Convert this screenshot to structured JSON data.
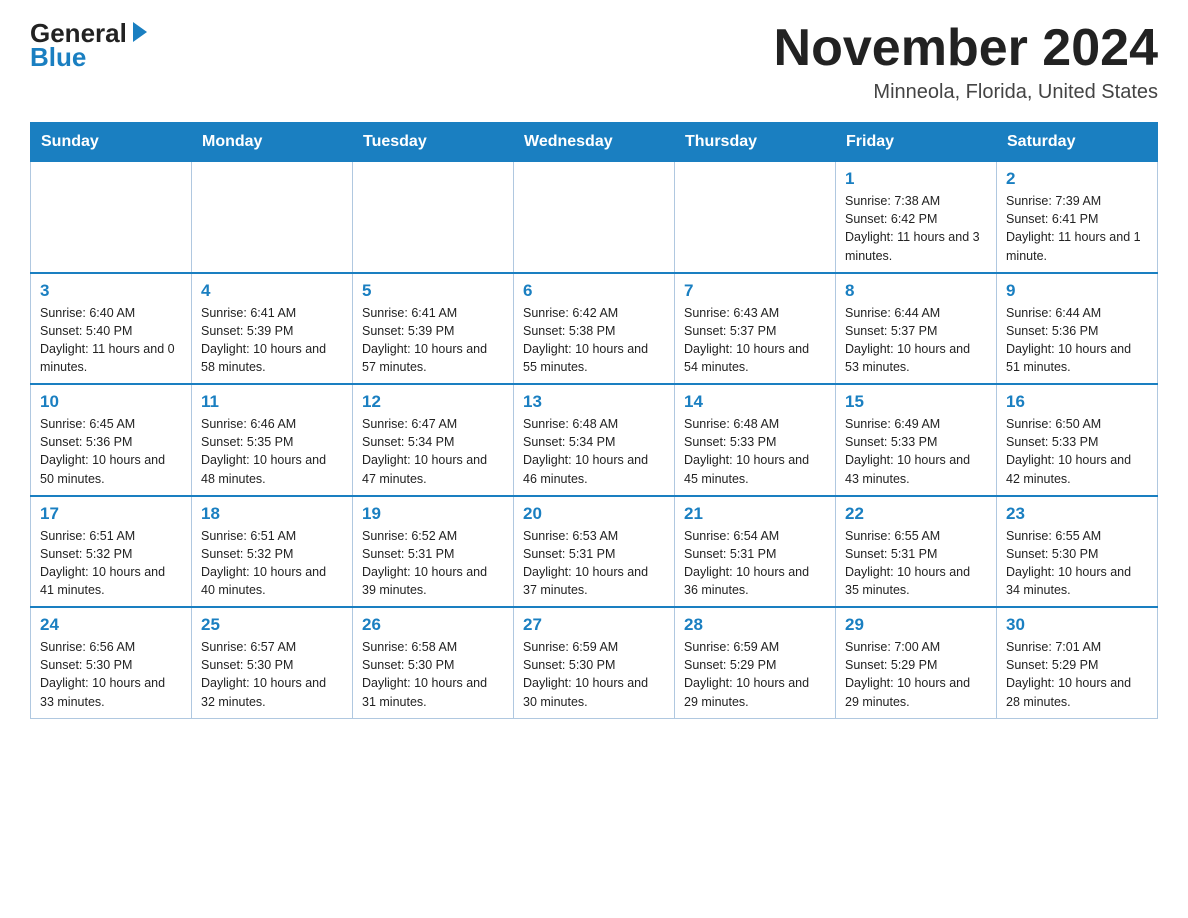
{
  "logo": {
    "general": "General",
    "blue": "Blue"
  },
  "header": {
    "title": "November 2024",
    "subtitle": "Minneola, Florida, United States"
  },
  "days_of_week": [
    "Sunday",
    "Monday",
    "Tuesday",
    "Wednesday",
    "Thursday",
    "Friday",
    "Saturday"
  ],
  "weeks": [
    [
      {
        "day": "",
        "info": ""
      },
      {
        "day": "",
        "info": ""
      },
      {
        "day": "",
        "info": ""
      },
      {
        "day": "",
        "info": ""
      },
      {
        "day": "",
        "info": ""
      },
      {
        "day": "1",
        "info": "Sunrise: 7:38 AM\nSunset: 6:42 PM\nDaylight: 11 hours and 3 minutes."
      },
      {
        "day": "2",
        "info": "Sunrise: 7:39 AM\nSunset: 6:41 PM\nDaylight: 11 hours and 1 minute."
      }
    ],
    [
      {
        "day": "3",
        "info": "Sunrise: 6:40 AM\nSunset: 5:40 PM\nDaylight: 11 hours and 0 minutes."
      },
      {
        "day": "4",
        "info": "Sunrise: 6:41 AM\nSunset: 5:39 PM\nDaylight: 10 hours and 58 minutes."
      },
      {
        "day": "5",
        "info": "Sunrise: 6:41 AM\nSunset: 5:39 PM\nDaylight: 10 hours and 57 minutes."
      },
      {
        "day": "6",
        "info": "Sunrise: 6:42 AM\nSunset: 5:38 PM\nDaylight: 10 hours and 55 minutes."
      },
      {
        "day": "7",
        "info": "Sunrise: 6:43 AM\nSunset: 5:37 PM\nDaylight: 10 hours and 54 minutes."
      },
      {
        "day": "8",
        "info": "Sunrise: 6:44 AM\nSunset: 5:37 PM\nDaylight: 10 hours and 53 minutes."
      },
      {
        "day": "9",
        "info": "Sunrise: 6:44 AM\nSunset: 5:36 PM\nDaylight: 10 hours and 51 minutes."
      }
    ],
    [
      {
        "day": "10",
        "info": "Sunrise: 6:45 AM\nSunset: 5:36 PM\nDaylight: 10 hours and 50 minutes."
      },
      {
        "day": "11",
        "info": "Sunrise: 6:46 AM\nSunset: 5:35 PM\nDaylight: 10 hours and 48 minutes."
      },
      {
        "day": "12",
        "info": "Sunrise: 6:47 AM\nSunset: 5:34 PM\nDaylight: 10 hours and 47 minutes."
      },
      {
        "day": "13",
        "info": "Sunrise: 6:48 AM\nSunset: 5:34 PM\nDaylight: 10 hours and 46 minutes."
      },
      {
        "day": "14",
        "info": "Sunrise: 6:48 AM\nSunset: 5:33 PM\nDaylight: 10 hours and 45 minutes."
      },
      {
        "day": "15",
        "info": "Sunrise: 6:49 AM\nSunset: 5:33 PM\nDaylight: 10 hours and 43 minutes."
      },
      {
        "day": "16",
        "info": "Sunrise: 6:50 AM\nSunset: 5:33 PM\nDaylight: 10 hours and 42 minutes."
      }
    ],
    [
      {
        "day": "17",
        "info": "Sunrise: 6:51 AM\nSunset: 5:32 PM\nDaylight: 10 hours and 41 minutes."
      },
      {
        "day": "18",
        "info": "Sunrise: 6:51 AM\nSunset: 5:32 PM\nDaylight: 10 hours and 40 minutes."
      },
      {
        "day": "19",
        "info": "Sunrise: 6:52 AM\nSunset: 5:31 PM\nDaylight: 10 hours and 39 minutes."
      },
      {
        "day": "20",
        "info": "Sunrise: 6:53 AM\nSunset: 5:31 PM\nDaylight: 10 hours and 37 minutes."
      },
      {
        "day": "21",
        "info": "Sunrise: 6:54 AM\nSunset: 5:31 PM\nDaylight: 10 hours and 36 minutes."
      },
      {
        "day": "22",
        "info": "Sunrise: 6:55 AM\nSunset: 5:31 PM\nDaylight: 10 hours and 35 minutes."
      },
      {
        "day": "23",
        "info": "Sunrise: 6:55 AM\nSunset: 5:30 PM\nDaylight: 10 hours and 34 minutes."
      }
    ],
    [
      {
        "day": "24",
        "info": "Sunrise: 6:56 AM\nSunset: 5:30 PM\nDaylight: 10 hours and 33 minutes."
      },
      {
        "day": "25",
        "info": "Sunrise: 6:57 AM\nSunset: 5:30 PM\nDaylight: 10 hours and 32 minutes."
      },
      {
        "day": "26",
        "info": "Sunrise: 6:58 AM\nSunset: 5:30 PM\nDaylight: 10 hours and 31 minutes."
      },
      {
        "day": "27",
        "info": "Sunrise: 6:59 AM\nSunset: 5:30 PM\nDaylight: 10 hours and 30 minutes."
      },
      {
        "day": "28",
        "info": "Sunrise: 6:59 AM\nSunset: 5:29 PM\nDaylight: 10 hours and 29 minutes."
      },
      {
        "day": "29",
        "info": "Sunrise: 7:00 AM\nSunset: 5:29 PM\nDaylight: 10 hours and 29 minutes."
      },
      {
        "day": "30",
        "info": "Sunrise: 7:01 AM\nSunset: 5:29 PM\nDaylight: 10 hours and 28 minutes."
      }
    ]
  ]
}
